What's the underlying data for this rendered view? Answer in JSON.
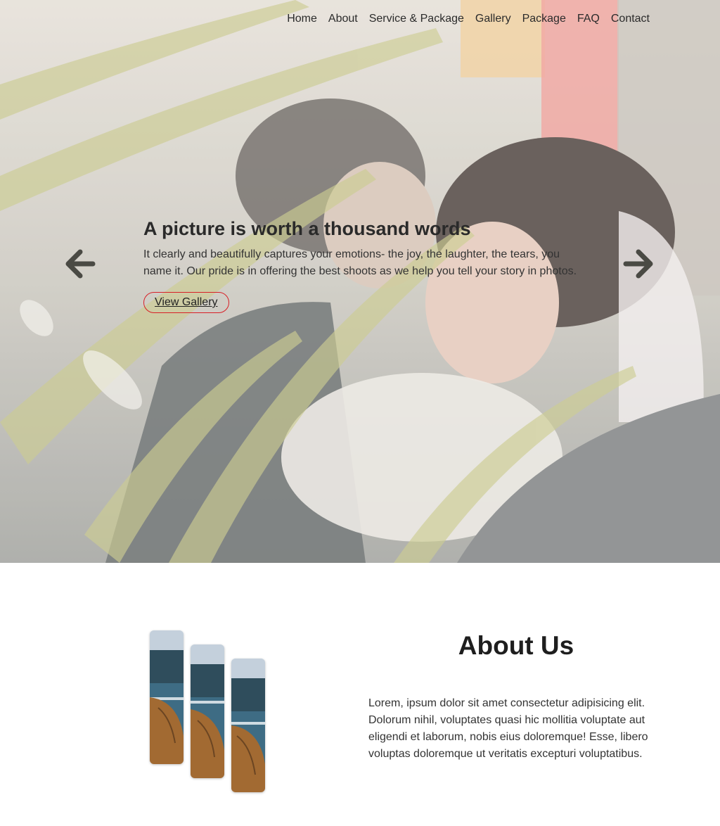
{
  "nav": {
    "items": [
      {
        "label": "Home",
        "name": "nav-home"
      },
      {
        "label": "About",
        "name": "nav-about"
      },
      {
        "label": "Service & Package",
        "name": "nav-service-package"
      },
      {
        "label": "Gallery",
        "name": "nav-gallery"
      },
      {
        "label": "Package",
        "name": "nav-package"
      },
      {
        "label": "FAQ",
        "name": "nav-faq"
      },
      {
        "label": "Contact",
        "name": "nav-contact"
      }
    ]
  },
  "hero": {
    "title": "A picture is worth a thousand words",
    "text": "It clearly and beautifully captures your emotions- the joy, the laughter, the tears, you name it. Our pride is in offering the best shoots as we help you tell your story in photos.",
    "button_label": "View Gallery",
    "prev_icon": "arrow-left-icon",
    "next_icon": "arrow-right-icon",
    "button_border_color": "#d81f26"
  },
  "about": {
    "title": "About Us",
    "text": "Lorem, ipsum dolor sit amet consectetur adipisicing elit. Dolorum nihil, voluptates quasi hic mollitia voluptate aut eligendi et laborum, nobis eius doloremque! Esse, libero voluptas doloremque ut veritatis excepturi voluptatibus."
  }
}
